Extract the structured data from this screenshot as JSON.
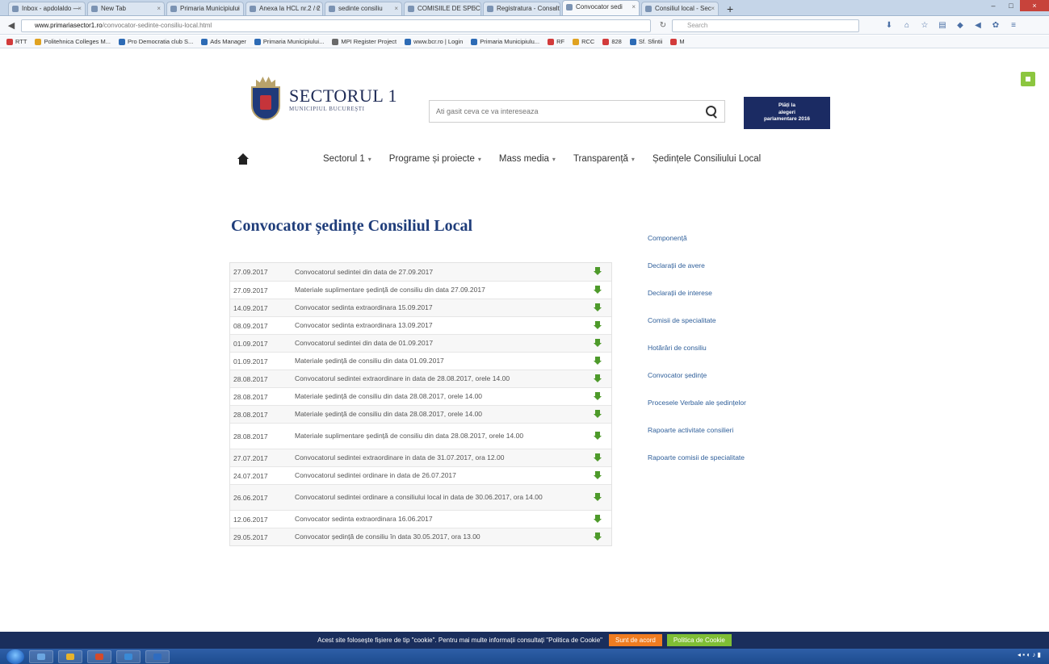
{
  "browser": {
    "tabs": [
      {
        "label": "Inbox - apdolaldo —"
      },
      {
        "label": "New Tab"
      },
      {
        "label": "Primaria Municipiului"
      },
      {
        "label": "Anexa la HCL nr.2 / 2"
      },
      {
        "label": "sedinte consiliu"
      },
      {
        "label": "COMISIILE DE SPECIALI"
      },
      {
        "label": "Registratura - Consult"
      },
      {
        "label": "Convocator sedi"
      },
      {
        "label": "Consiliul local - Sec"
      }
    ],
    "url_host": "www.primariasector1.ro",
    "url_path": "/convocator-sedinte-consiliu-local.html",
    "search_placeholder": "Search",
    "bookmarks": [
      {
        "label": "RTT",
        "color": "#d23b3b"
      },
      {
        "label": "Politehnica Colleges M...",
        "color": "#e0a220"
      },
      {
        "label": "Pro Democratia club S...",
        "color": "#2d6bb5"
      },
      {
        "label": "Ads Manager",
        "color": "#2d6bb5"
      },
      {
        "label": "Primaria Municipiului...",
        "color": "#2d6bb5"
      },
      {
        "label": "MPI Register Project",
        "color": "#6a6a6a"
      },
      {
        "label": "www.bcr.ro | Login",
        "color": "#2d6bb5"
      },
      {
        "label": "Primaria Municipiulu...",
        "color": "#2d6bb5"
      },
      {
        "label": "RF",
        "color": "#d23b3b"
      },
      {
        "label": "RCC",
        "color": "#e0a220"
      },
      {
        "label": "828",
        "color": "#d23b3b"
      },
      {
        "label": "Sf. Sfintii",
        "color": "#2d6bb5"
      },
      {
        "label": "M",
        "color": "#d23b3b"
      }
    ]
  },
  "site": {
    "logo_title": "SECTORUL 1",
    "logo_subtitle": "MUNICIPIUL BUCUREŞTI",
    "search_placeholder": "Ati gasit ceva ce va intereseaza",
    "promo": "Plăți la\n alegeri\nparlamentare 2016",
    "nav": [
      {
        "label": "Sectorul 1"
      },
      {
        "label": "Programe și proiecte"
      },
      {
        "label": "Mass media"
      },
      {
        "label": "Transparență"
      },
      {
        "label": "Ședințele Consiliului Local"
      }
    ],
    "page_title": "Convocator ședințe Consiliul Local",
    "sidebar": [
      {
        "label": "Componență"
      },
      {
        "label": "Declarații de avere"
      },
      {
        "label": "Declarații de interese"
      },
      {
        "label": "Comisii de specialitate"
      },
      {
        "label": "Hotărâri de consiliu"
      },
      {
        "label": "Convocator ședințe"
      },
      {
        "label": "Procesele Verbale ale ședințelor"
      },
      {
        "label": "Rapoarte activitate consilieri"
      },
      {
        "label": "Rapoarte comisii de specialitate"
      }
    ],
    "rows": [
      {
        "date": "27.09.2017",
        "title": "Convocatorul sedintei din data de 27.09.2017"
      },
      {
        "date": "27.09.2017",
        "title": "Materiale suplimentare ședință de consiliu din data 27.09.2017"
      },
      {
        "date": "14.09.2017",
        "title": "Convocator sedinta extraordinara 15.09.2017"
      },
      {
        "date": "08.09.2017",
        "title": "Convocator sedinta extraordinara 13.09.2017"
      },
      {
        "date": "01.09.2017",
        "title": "Convocatorul sedintei din data de 01.09.2017"
      },
      {
        "date": "01.09.2017",
        "title": "Materiale ședință de consiliu din data 01.09.2017"
      },
      {
        "date": "28.08.2017",
        "title": "Convocatorul sedintei extraordinare in data de 28.08.2017, orele 14.00"
      },
      {
        "date": "28.08.2017",
        "title": "Materiale ședință de consiliu din data 28.08.2017, orele 14.00"
      },
      {
        "date": "28.08.2017",
        "title": "Materiale ședință de consiliu din data 28.08.2017, orele 14.00"
      },
      {
        "date": "28.08.2017",
        "title": "Materiale suplimentare ședință de consiliu din data 28.08.2017, orele 14.00"
      },
      {
        "date": "27.07.2017",
        "title": "Convocatorul sedintei extraordinare in data de 31.07.2017, ora 12.00"
      },
      {
        "date": "24.07.2017",
        "title": "Convocatorul sedintei ordinare in data de 26.07.2017"
      },
      {
        "date": "26.06.2017",
        "title": "Convocatorul sedintei ordinare a consiliului local in data de 30.06.2017, ora 14.00"
      },
      {
        "date": "12.06.2017",
        "title": "Convocator sedinta extraordinara 16.06.2017"
      },
      {
        "date": "29.05.2017",
        "title": "Convocator ședință de consiliu în data 30.05.2017, ora 13.00"
      }
    ],
    "cookie_text": "Acest site folosește fișiere de tip \"cookie\". Pentru mai multe informații consultați \"Politica de Cookie\"",
    "cookie_accept": "Sunt de acord",
    "cookie_policy": "Politica de Cookie"
  },
  "colors": {
    "brand_navy": "#1b2b63",
    "link_blue": "#2f5f9a",
    "download_green": "#4e9a2b",
    "cookie_orange": "#f07c20",
    "cookie_green": "#7fbe35"
  },
  "icons": {
    "download": "download-icon",
    "search": "search-icon",
    "home": "home-icon"
  }
}
